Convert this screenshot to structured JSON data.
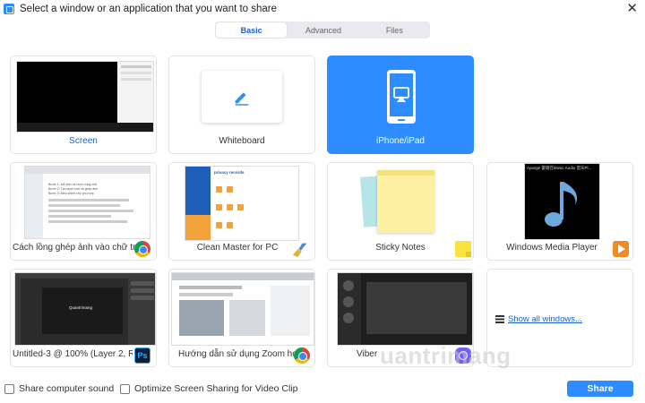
{
  "window": {
    "title": "Select a window or an application that you want to share",
    "close_glyph": "✕"
  },
  "tabs": [
    {
      "label": "Basic",
      "active": true
    },
    {
      "label": "Advanced",
      "active": false
    },
    {
      "label": "Files",
      "active": false
    }
  ],
  "tiles": [
    {
      "label": "Screen",
      "icon": "monitor-icon"
    },
    {
      "label": "Whiteboard",
      "icon": "pencil-icon"
    },
    {
      "label": "iPhone/iPad",
      "icon": "airplay-icon",
      "selected": true
    },
    {
      "label": "Cách lồng ghép ảnh vào chữ tro...",
      "app_icon": "chrome-icon"
    },
    {
      "label": "Clean Master for PC",
      "app_icon": "broom-icon"
    },
    {
      "label": "Sticky Notes",
      "app_icon": "sticky-notes-icon"
    },
    {
      "label": "Windows Media Player",
      "app_icon": "media-player-icon",
      "thumb_text": "Ayange 雷雨在Music Audio 音乐Pl..."
    },
    {
      "label": "Untitled-3 @ 100% (Layer 2, RGB/...",
      "app_icon": "photoshop-icon",
      "app_text": "Ps"
    },
    {
      "label": "Hướng dẫn sử dụng Zoom học tr...",
      "app_icon": "chrome-icon"
    },
    {
      "label": "Viber",
      "app_icon": "viber-icon"
    },
    {
      "label": "Show all windows...",
      "icon": "show-windows-icon"
    }
  ],
  "thumb_text": {
    "clean_master_header": "privacy records",
    "doc_lines": [
      "Bước 1: Mở ảnh và chọn vùng chữ",
      "Bước 2: Tạo layer mới và ghép ảnh",
      "Bước 3: Điều chỉnh cho phù hợp"
    ],
    "photoshop_title": "Quantrimang"
  },
  "options": [
    {
      "label": "Share computer sound",
      "checked": false
    },
    {
      "label": "Optimize Screen Sharing for Video Clip",
      "checked": false
    }
  ],
  "share_button": {
    "label": "Share"
  },
  "watermark": "uantrimang",
  "colors": {
    "accent": "#2d8cff",
    "tab_active_text": "#1a5fd6"
  }
}
